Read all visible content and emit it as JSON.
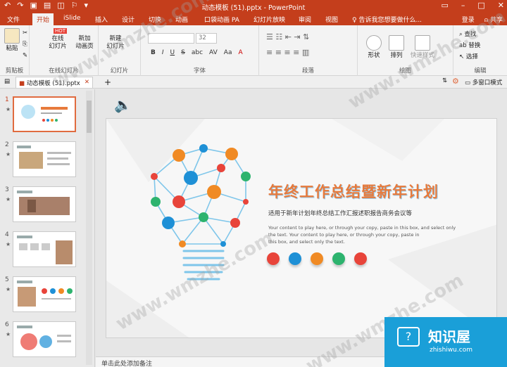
{
  "titlebar": {
    "document_title": "动态模板 (51).pptx - PowerPoint"
  },
  "tabs": [
    "文件",
    "开始",
    "iSlide",
    "插入",
    "设计",
    "切换",
    "动画",
    "口袋动画 PA",
    "幻灯片放映",
    "审阅",
    "视图"
  ],
  "tell_me": "告诉我您想要做什么...",
  "login": "登录",
  "share": "共享",
  "ribbon": {
    "clipboard": {
      "paste": "粘贴",
      "label": "剪贴板"
    },
    "online": {
      "btn1": "在线\n幻灯片",
      "btn2": "新加\n动画页",
      "label": "在线幻灯片",
      "hot": "HOT"
    },
    "slides": {
      "new_slide": "新建\n幻灯片",
      "label": "幻灯片"
    },
    "font": {
      "label": "字体",
      "size": "32",
      "format_buttons": [
        "B",
        "I",
        "U",
        "S",
        "abc",
        "AV",
        "Aa",
        "A"
      ]
    },
    "paragraph": {
      "label": "段落"
    },
    "drawing": {
      "shapes": "形状",
      "arrange": "排列",
      "quick_styles": "快速样式",
      "label": "绘图"
    },
    "editing": {
      "find": "查找",
      "replace": "替换",
      "select": "选择",
      "label": "编辑"
    }
  },
  "doc_tab": {
    "name": "动态模板 (51).pptx"
  },
  "view_mode": "多窗口模式",
  "thumbnails": [
    {
      "num": "1",
      "star": "★"
    },
    {
      "num": "2",
      "star": "★"
    },
    {
      "num": "3",
      "star": "★"
    },
    {
      "num": "4",
      "star": "★"
    },
    {
      "num": "5",
      "star": "★"
    },
    {
      "num": "6",
      "star": "★"
    }
  ],
  "slide": {
    "title": "年终工作总结暨新年计划",
    "subtitle": "适用于新年计划年终总结工作汇报述职报告商务会议等",
    "body_line1": "Your content to play here, or through your copy, paste in this box, and select only",
    "body_line2": "the text. Your content to play here, or through your copy, paste in",
    "body_line3": "this box, and select only the text.",
    "icon_colors": [
      "#e8443a",
      "#1e90d6",
      "#f08a24",
      "#2db36e",
      "#e8443a"
    ]
  },
  "notes_placeholder": "单击此处添加备注",
  "watermark": "www.wmzhe.com",
  "brand": {
    "name": "知识屋",
    "domain": "zhishiwu.com"
  }
}
